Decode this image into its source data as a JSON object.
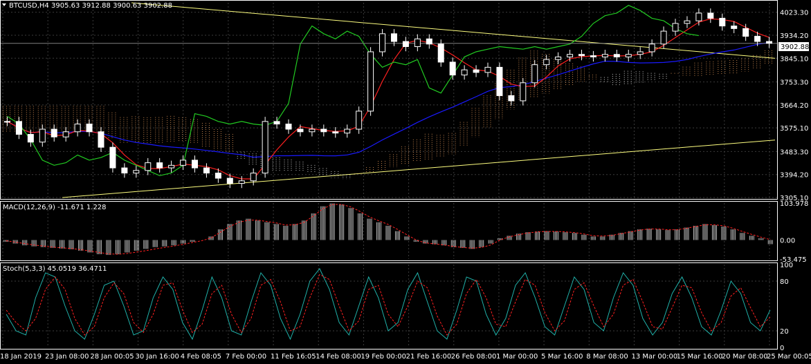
{
  "header": {
    "symbol": "BTCUSD,H4",
    "ohlc": "3905.63 3912.88 3900.63 3902.88"
  },
  "colors": {
    "background": "#000000",
    "grid": "#3c3c3c",
    "bull_candle": "#ffffff",
    "bear_candle": "#ffffff",
    "trendline": "#ffff80",
    "ma_slow": "#1a1aff",
    "tenkan": "#ff2020",
    "chikou": "#22cc22",
    "kumo_a": "#f4a460",
    "kumo_b": "#ffffff",
    "macd_hist": "#c0c0c0",
    "macd_signal": "#ff2020",
    "stoch_main": "#20b2aa",
    "stoch_signal": "#ff2020",
    "price_tag_bg": "#ffffff",
    "price_tag_text": "#000000"
  },
  "chart_data": [
    {
      "type": "candlestick",
      "panel": "price",
      "title": "BTCUSD,H4",
      "current_price": 3902.88,
      "current_price_label": "3902.88",
      "ylim": [
        3305.1,
        4060
      ],
      "y_ticks": [
        "4023.30",
        "3934.20",
        "3845.10",
        "3753.30",
        "3664.20",
        "3575.10",
        "3483.30",
        "3394.20",
        "3305.10"
      ],
      "y_tick_values": [
        4023.3,
        3934.2,
        3845.1,
        3753.3,
        3664.2,
        3575.1,
        3483.3,
        3394.2,
        3305.1
      ],
      "x_ticks": [
        "18 Jan 2019",
        "23 Jan 08:00",
        "28 Jan 00:05",
        "30 Jan 16:00",
        "4 Feb 08:05",
        "7 Feb 00:00",
        "11 Feb 16:05",
        "14 Feb 08:00",
        "19 Feb 00:00",
        "21 Feb 16:00",
        "26 Feb 08:00",
        "1 Mar 00:00",
        "5 Mar 16:00",
        "8 Mar 08:00",
        "13 Mar 00:00",
        "15 Mar 16:00",
        "20 Mar 08:00",
        "25 Mar 00:05"
      ],
      "series": [
        {
          "name": "close",
          "values": [
            3600,
            3550,
            3520,
            3570,
            3540,
            3560,
            3590,
            3560,
            3500,
            3420,
            3400,
            3410,
            3440,
            3420,
            3430,
            3450,
            3420,
            3400,
            3380,
            3360,
            3370,
            3400,
            3600,
            3590,
            3570,
            3560,
            3570,
            3560,
            3555,
            3570,
            3640,
            3870,
            3940,
            3910,
            3890,
            3920,
            3900,
            3830,
            3780,
            3800,
            3790,
            3810,
            3700,
            3680,
            3750,
            3820,
            3840,
            3850,
            3860,
            3855,
            3850,
            3860,
            3850,
            3860,
            3870,
            3900,
            3950,
            3980,
            3990,
            4020,
            4000,
            3970,
            3960,
            3930,
            3910,
            3902.88
          ]
        }
      ]
    },
    {
      "type": "macd",
      "panel": "macd",
      "title": "MACD(12,26,9) -11.671 1.228",
      "ylim": [
        -53.475,
        103.978
      ],
      "y_ticks": [
        "103.978",
        "0.00",
        "-53.475"
      ],
      "y_tick_values": [
        103.978,
        0,
        -53.475
      ],
      "series": [
        {
          "name": "main",
          "values": [
            -5,
            -10,
            -15,
            -18,
            -20,
            -22,
            -24,
            -26,
            -30,
            -35,
            -40,
            -42,
            -40,
            -35,
            -30,
            -25,
            -20,
            -18,
            -15,
            -10,
            -5,
            0,
            10,
            30,
            45,
            55,
            60,
            55,
            50,
            45,
            40,
            45,
            55,
            75,
            95,
            103,
            100,
            90,
            75,
            60,
            50,
            40,
            25,
            10,
            -5,
            -10,
            -12,
            -15,
            -20,
            -22,
            -25,
            -20,
            -10,
            5,
            12,
            18,
            22,
            24,
            25,
            24,
            22,
            20,
            15,
            10,
            10,
            15,
            20,
            25,
            30,
            32,
            30,
            28,
            30,
            35,
            40,
            45,
            42,
            38,
            30,
            20,
            12,
            5,
            -11.671
          ]
        },
        {
          "name": "signal",
          "values": [
            -2,
            -6,
            -10,
            -14,
            -17,
            -20,
            -22,
            -24,
            -27,
            -31,
            -35,
            -39,
            -40,
            -38,
            -34,
            -30,
            -25,
            -21,
            -17,
            -12,
            -7,
            -2,
            6,
            22,
            38,
            50,
            56,
            56,
            52,
            48,
            42,
            43,
            50,
            68,
            88,
            100,
            100,
            93,
            80,
            65,
            54,
            44,
            30,
            15,
            0,
            -8,
            -11,
            -14,
            -18,
            -21,
            -23,
            -21,
            -14,
            0,
            9,
            15,
            20,
            23,
            24,
            24,
            23,
            21,
            17,
            12,
            11,
            13,
            18,
            23,
            28,
            31,
            31,
            29,
            29,
            33,
            38,
            43,
            43,
            40,
            33,
            24,
            16,
            8,
            1.228
          ]
        }
      ]
    },
    {
      "type": "stochastic",
      "panel": "stoch",
      "title": "Stoch(5,3,3) 45.0519 36.4711",
      "ylim": [
        0,
        100
      ],
      "y_ticks": [
        "100",
        "80",
        "20",
        "0"
      ],
      "y_tick_values": [
        100,
        80,
        20,
        0
      ],
      "series": [
        {
          "name": "main",
          "values": [
            40,
            20,
            15,
            60,
            90,
            85,
            50,
            20,
            10,
            40,
            75,
            80,
            50,
            15,
            20,
            60,
            85,
            70,
            30,
            10,
            45,
            85,
            60,
            20,
            15,
            55,
            90,
            75,
            35,
            10,
            40,
            80,
            95,
            70,
            30,
            15,
            50,
            85,
            60,
            20,
            30,
            70,
            90,
            55,
            20,
            10,
            45,
            85,
            80,
            40,
            15,
            35,
            75,
            90,
            60,
            25,
            15,
            50,
            85,
            70,
            30,
            20,
            60,
            90,
            75,
            35,
            15,
            30,
            65,
            85,
            60,
            25,
            15,
            45,
            80,
            65,
            30,
            20,
            45.0519
          ]
        },
        {
          "name": "signal",
          "values": [
            45,
            30,
            20,
            35,
            70,
            85,
            70,
            35,
            15,
            25,
            60,
            78,
            65,
            30,
            18,
            40,
            75,
            78,
            45,
            18,
            28,
            65,
            75,
            40,
            18,
            35,
            75,
            82,
            55,
            20,
            25,
            60,
            88,
            82,
            50,
            20,
            32,
            70,
            75,
            40,
            25,
            50,
            80,
            72,
            38,
            15,
            28,
            65,
            82,
            60,
            28,
            25,
            55,
            82,
            75,
            42,
            20,
            32,
            70,
            78,
            50,
            25,
            40,
            75,
            82,
            55,
            25,
            22,
            48,
            75,
            72,
            42,
            20,
            30,
            62,
            72,
            48,
            25,
            36.4711
          ]
        }
      ]
    }
  ]
}
